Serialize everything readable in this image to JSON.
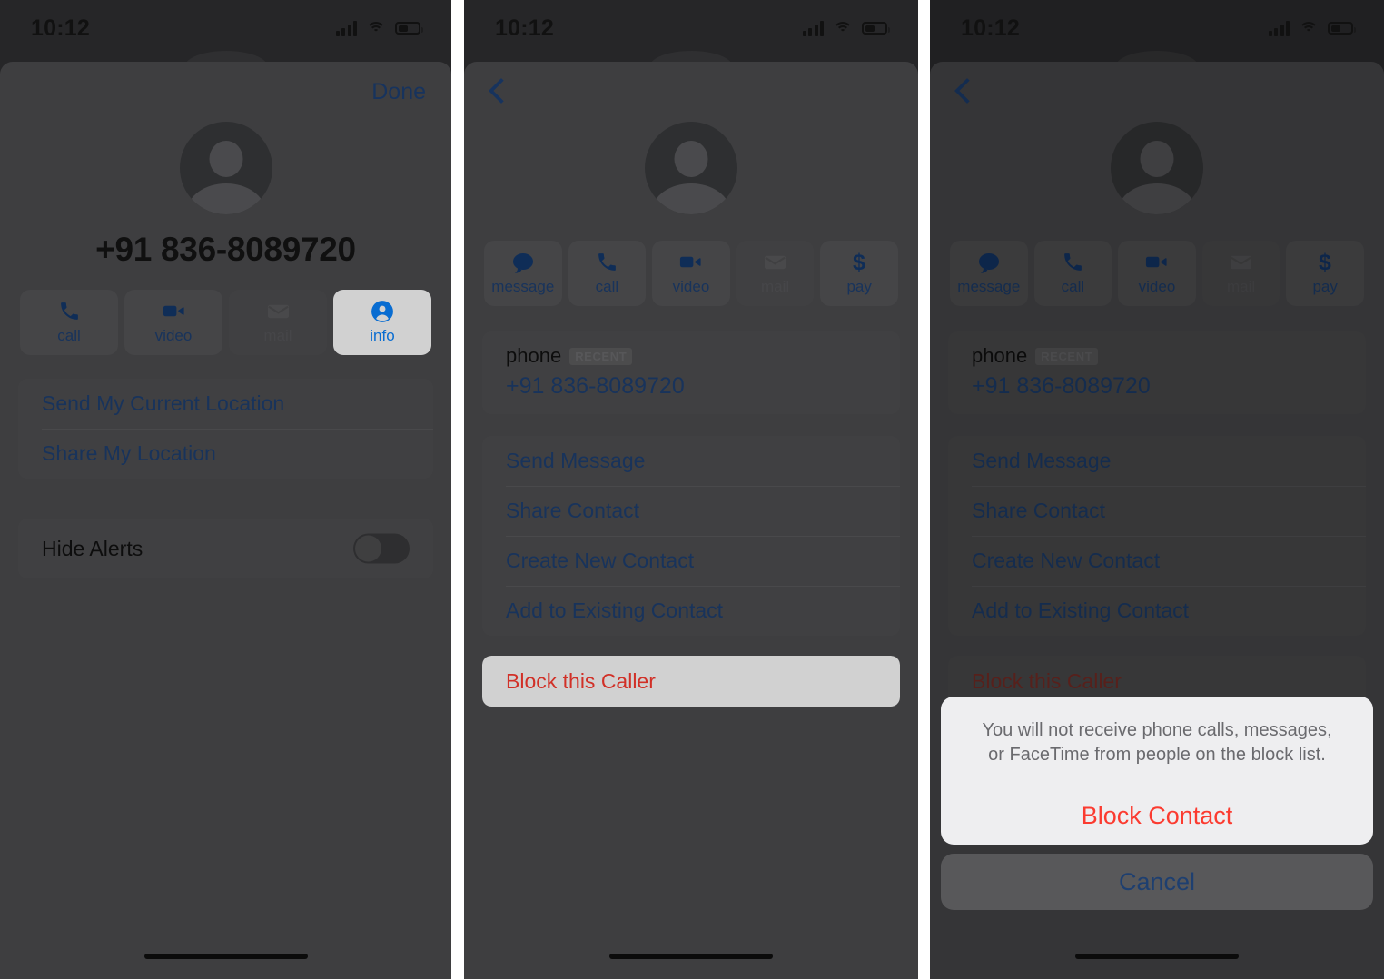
{
  "statusbar": {
    "time": "10:12",
    "signal_icon": "cellular-bars-icon",
    "wifi_icon": "wifi-icon",
    "battery_icon": "battery-icon"
  },
  "colors": {
    "ios_blue": "#0a84ff",
    "muted_blue": "#1e3f70",
    "destructive_red": "#ff3b30",
    "sheet_bg": "#eeeef0",
    "card_bg": "#4c4c4f"
  },
  "contact": {
    "phone_number": "+91 836-8089720",
    "avatar_icon": "person-placeholder-icon"
  },
  "panel1": {
    "done_label": "Done",
    "tiles": [
      {
        "label": "call",
        "icon": "phone-icon",
        "state": "normal"
      },
      {
        "label": "video",
        "icon": "video-icon",
        "state": "normal"
      },
      {
        "label": "mail",
        "icon": "mail-icon",
        "state": "disabled"
      },
      {
        "label": "info",
        "icon": "info-person-icon",
        "state": "highlighted"
      }
    ],
    "location_items": [
      "Send My Current Location",
      "Share My Location"
    ],
    "hide_alerts": {
      "label": "Hide Alerts",
      "value": "off"
    }
  },
  "panel2": {
    "back_icon": "chevron-left-icon",
    "tiles": [
      {
        "label": "message",
        "icon": "message-bubble-icon",
        "state": "normal"
      },
      {
        "label": "call",
        "icon": "phone-icon",
        "state": "normal"
      },
      {
        "label": "video",
        "icon": "video-icon",
        "state": "normal"
      },
      {
        "label": "mail",
        "icon": "mail-icon",
        "state": "disabled"
      },
      {
        "label": "pay",
        "icon": "dollar-icon",
        "state": "normal"
      }
    ],
    "phone_label": "phone",
    "phone_badge": "RECENT",
    "phone_value": "+91 836-8089720",
    "menu_items": [
      "Send Message",
      "Share Contact",
      "Create New Contact",
      "Add to Existing Contact"
    ],
    "block_label": "Block this Caller"
  },
  "panel3": {
    "back_icon": "chevron-left-icon",
    "tiles": [
      {
        "label": "message",
        "icon": "message-bubble-icon",
        "state": "normal"
      },
      {
        "label": "call",
        "icon": "phone-icon",
        "state": "normal"
      },
      {
        "label": "video",
        "icon": "video-icon",
        "state": "normal"
      },
      {
        "label": "mail",
        "icon": "mail-icon",
        "state": "disabled"
      },
      {
        "label": "pay",
        "icon": "dollar-icon",
        "state": "normal"
      }
    ],
    "phone_label": "phone",
    "phone_badge": "RECENT",
    "phone_value": "+91 836-8089720",
    "menu_items": [
      "Send Message",
      "Share Contact",
      "Create New Contact",
      "Add to Existing Contact"
    ],
    "block_label": "Block this Caller",
    "action_sheet": {
      "message": "You will not receive phone calls, messages, or FaceTime from people on the block list.",
      "confirm_label": "Block Contact",
      "cancel_label": "Cancel"
    }
  }
}
